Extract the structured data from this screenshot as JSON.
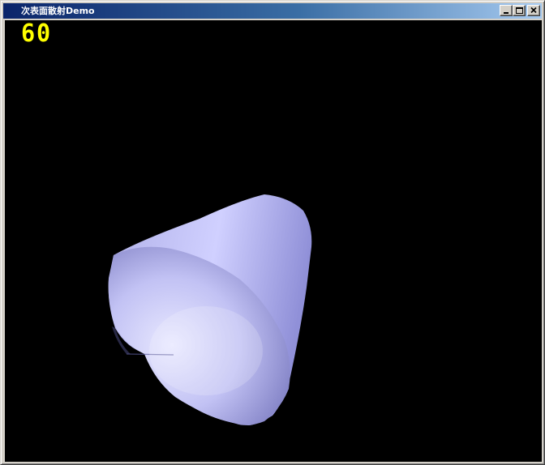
{
  "window": {
    "title": "次表面散射Demo",
    "controls": {
      "minimize": "minimize",
      "maximize": "maximize",
      "close": "close"
    }
  },
  "overlay": {
    "fps": "60"
  },
  "scene": {
    "background_color": "#000000",
    "object": "cone",
    "object_color": "#c8c8ff",
    "fps_color": "#ffff00"
  }
}
